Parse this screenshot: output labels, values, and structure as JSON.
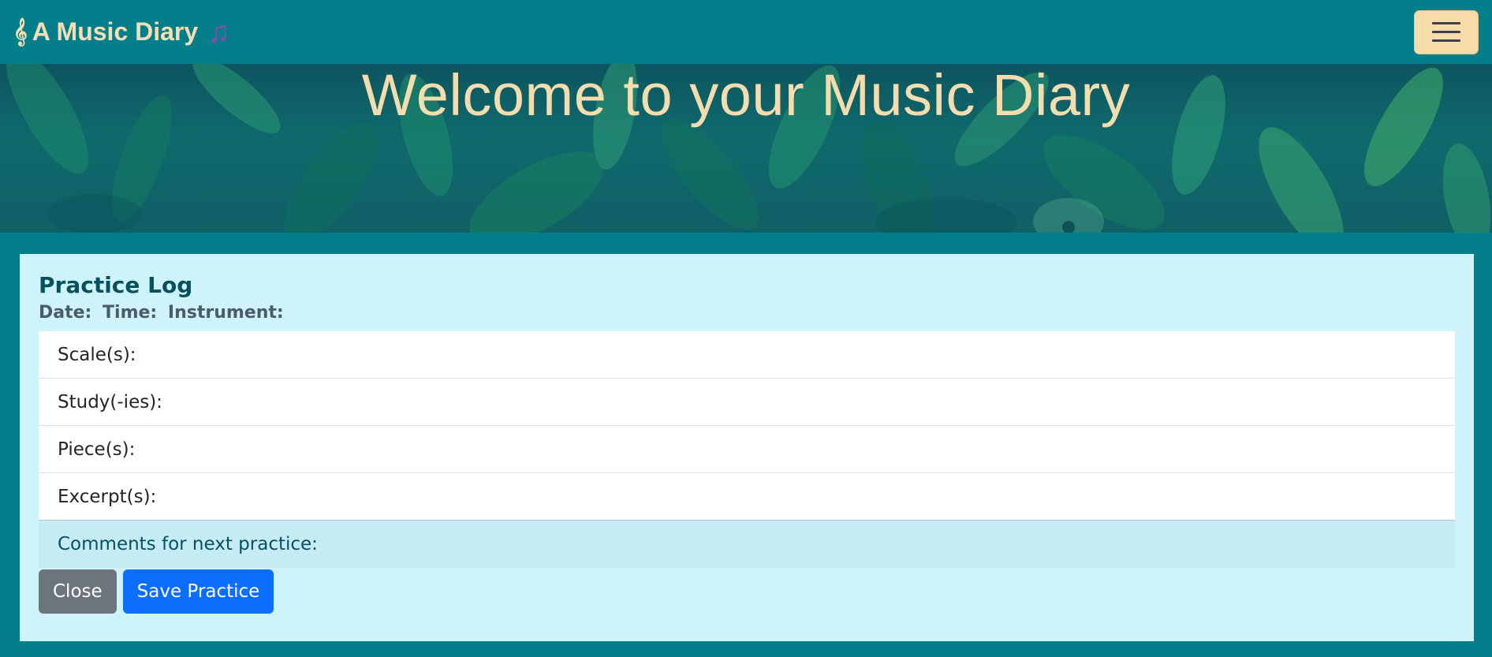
{
  "navbar": {
    "brand_text": "A Music Diary",
    "clef_glyph": "𝄞",
    "note_glyph": "♫",
    "toggler_icon": "hamburger-menu-icon"
  },
  "hero": {
    "title": "Welcome to your Music Diary"
  },
  "modal": {
    "title": "Practice Log",
    "meta": {
      "date_label": "Date:",
      "time_label": "Time:",
      "instrument_label": "Instrument:"
    },
    "items": [
      {
        "label": "Scale(s):"
      },
      {
        "label": "Study(-ies):"
      },
      {
        "label": "Piece(s):"
      },
      {
        "label": "Excerpt(s):"
      }
    ],
    "comments_label": "Comments for next practice:",
    "close_label": "Close",
    "save_label": "Save Practice"
  },
  "colors": {
    "navbar_bg": "#037f8c",
    "brand_text": "#f5deb3",
    "toggler_bg": "#f6dca8",
    "modal_bg": "#cff3fa",
    "title_color": "#055160",
    "close_button": "#6c757d",
    "save_button": "#0d6efd"
  }
}
